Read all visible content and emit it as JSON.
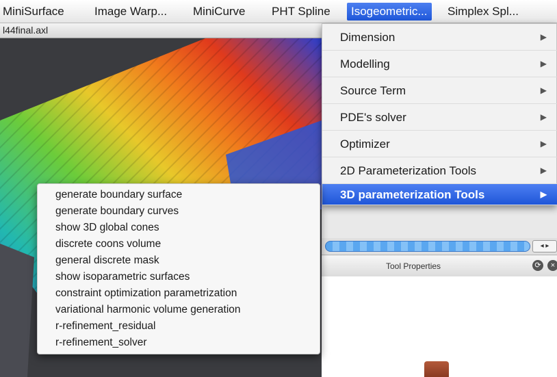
{
  "menubar": {
    "items": [
      {
        "label": "MiniSurface"
      },
      {
        "label": "Image Warp..."
      },
      {
        "label": "MiniCurve"
      },
      {
        "label": "PHT Spline"
      },
      {
        "label": "Isogeometric..."
      },
      {
        "label": "Simplex Spl..."
      }
    ]
  },
  "document": {
    "title": "l44final.axl"
  },
  "isogeometric_menu": {
    "items": [
      {
        "label": "Dimension",
        "arrow": "▶"
      },
      {
        "label": "Modelling",
        "arrow": "▶"
      },
      {
        "label": "Source Term",
        "arrow": "▶"
      },
      {
        "label": "PDE's solver",
        "arrow": "▶"
      },
      {
        "label": "Optimizer",
        "arrow": "▶"
      },
      {
        "label": "2D Parameterization Tools",
        "arrow": "▶"
      },
      {
        "label": "3D parameterization Tools",
        "arrow": "▶"
      }
    ]
  },
  "submenu_3d": {
    "items": [
      "generate boundary surface",
      "generate boundary curves",
      "show 3D global cones",
      "discrete coons volume",
      "general discrete mask",
      "show isoparametric surfaces",
      "constraint optimization parametrization",
      "variational harmonic volume generation",
      "r-refinement_residual",
      "r-refinement_solver"
    ]
  },
  "tool_properties": {
    "title": "Tool Properties",
    "stepper": "◂ ▸"
  },
  "colors": {
    "accent": "#2a62e0",
    "menu_bg": "#f2f2f2"
  }
}
